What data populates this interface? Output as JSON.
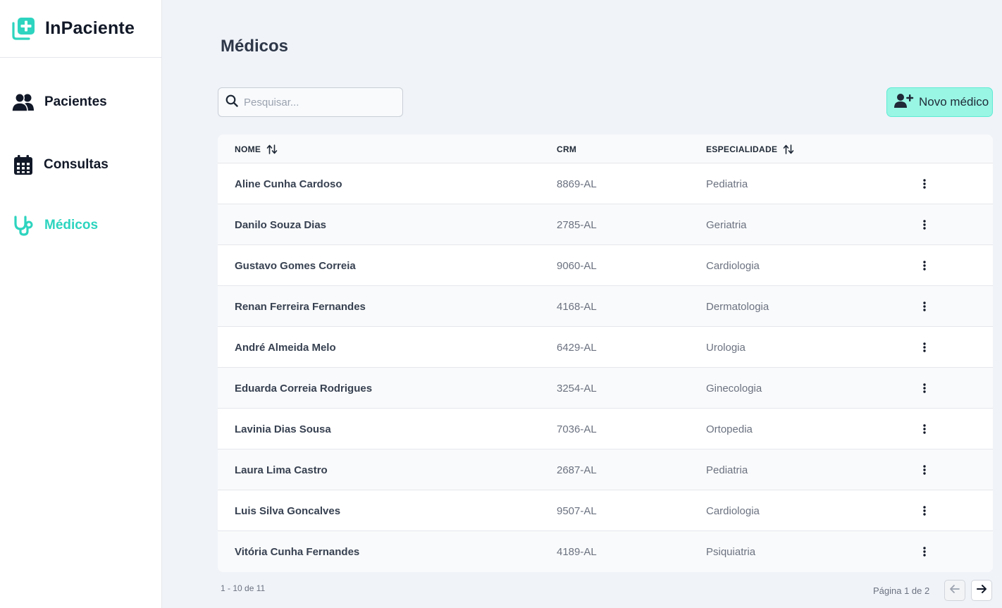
{
  "app": {
    "name": "InPaciente",
    "accent": "#2dd4bf"
  },
  "sidebar": {
    "items": [
      {
        "label": "Pacientes",
        "icon": "users-icon",
        "active": false
      },
      {
        "label": "Consultas",
        "icon": "calendar-icon",
        "active": false
      },
      {
        "label": "Médicos",
        "icon": "stethoscope-icon",
        "active": true
      }
    ]
  },
  "page": {
    "title": "Médicos"
  },
  "search": {
    "placeholder": "Pesquisar...",
    "value": ""
  },
  "toolbar": {
    "new_label": "Novo médico"
  },
  "table": {
    "headers": {
      "name": "NOME",
      "crm": "CRM",
      "specialty": "ESPECIALIDADE"
    },
    "rows": [
      {
        "name": "Aline Cunha Cardoso",
        "crm": "8869-AL",
        "specialty": "Pediatria"
      },
      {
        "name": "Danilo Souza Dias",
        "crm": "2785-AL",
        "specialty": "Geriatria"
      },
      {
        "name": "Gustavo Gomes Correia",
        "crm": "9060-AL",
        "specialty": "Cardiologia"
      },
      {
        "name": "Renan Ferreira Fernandes",
        "crm": "4168-AL",
        "specialty": "Dermatologia"
      },
      {
        "name": "André Almeida Melo",
        "crm": "6429-AL",
        "specialty": "Urologia"
      },
      {
        "name": "Eduarda Correia Rodrigues",
        "crm": "3254-AL",
        "specialty": "Ginecologia"
      },
      {
        "name": "Lavinia Dias Sousa",
        "crm": "7036-AL",
        "specialty": "Ortopedia"
      },
      {
        "name": "Laura Lima Castro",
        "crm": "2687-AL",
        "specialty": "Pediatria"
      },
      {
        "name": "Luis Silva Goncalves",
        "crm": "9507-AL",
        "specialty": "Cardiologia"
      },
      {
        "name": "Vitória Cunha Fernandes",
        "crm": "4189-AL",
        "specialty": "Psiquiatria"
      }
    ]
  },
  "pagination": {
    "count_text": "1 - 10 de 11",
    "page_text": "Página 1 de 2"
  }
}
